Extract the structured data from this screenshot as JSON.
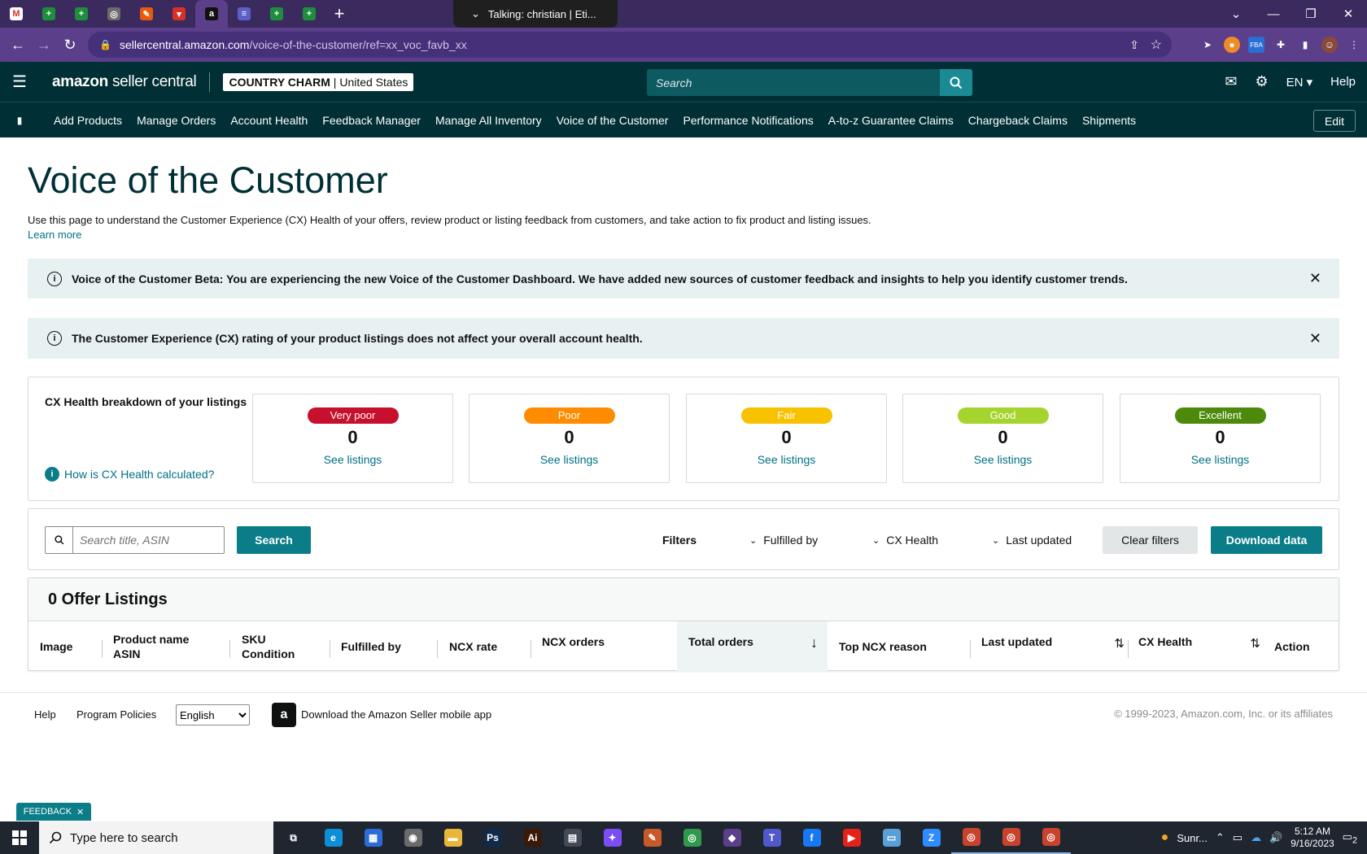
{
  "browser": {
    "tabs": [
      {
        "icon": "gmail-icon",
        "color": "#ffffff",
        "glyph": "M"
      },
      {
        "icon": "sheets-icon",
        "color": "#1e8e3e",
        "glyph": "+"
      },
      {
        "icon": "sheets-icon",
        "color": "#1e8e3e",
        "glyph": "+"
      },
      {
        "icon": "globe-icon",
        "color": "#6b6b6b",
        "glyph": "◎"
      },
      {
        "icon": "tool-icon",
        "color": "#e8590c",
        "glyph": "✎"
      },
      {
        "icon": "app-icon",
        "color": "#d93025",
        "glyph": "▾"
      },
      {
        "icon": "amazon-icon",
        "color": "#111111",
        "glyph": "a"
      },
      {
        "icon": "list-icon",
        "color": "#5b5fc7",
        "glyph": "≡"
      },
      {
        "icon": "sheets-icon",
        "color": "#1e8e3e",
        "glyph": "+"
      },
      {
        "icon": "sheets-icon",
        "color": "#1e8e3e",
        "glyph": "+"
      }
    ],
    "meeting": "Talking: christian | Eti...",
    "url_host": "sellercentral.amazon.com",
    "url_path": "/voice-of-the-customer/ref=xx_voc_favb_xx"
  },
  "header": {
    "logo_brand": "amazon",
    "logo_rest": "seller central",
    "store_name": "COUNTRY CHARM",
    "store_region": "United States",
    "search_placeholder": "Search",
    "language": "EN",
    "help": "Help"
  },
  "bookmarks": {
    "items": [
      "Add Products",
      "Manage Orders",
      "Account Health",
      "Feedback Manager",
      "Manage All Inventory",
      "Voice of the Customer",
      "Performance Notifications",
      "A-to-z Guarantee Claims",
      "Chargeback Claims",
      "Shipments"
    ],
    "edit": "Edit"
  },
  "page": {
    "title": "Voice of the Customer",
    "description": "Use this page to understand the Customer Experience (CX) Health of your offers, review product or listing feedback from customers, and take action to fix product and listing issues.",
    "learn_more": "Learn more"
  },
  "alerts": [
    "Voice of the Customer Beta: You are experiencing the new Voice of the Customer Dashboard. We have added new sources of customer feedback and insights to help you identify customer trends.",
    "The Customer Experience (CX) rating of your product listings does not affect your overall account health."
  ],
  "breakdown": {
    "title": "CX Health breakdown of your listings",
    "how_link": "How is CX Health calculated?",
    "cards": [
      {
        "label": "Very poor",
        "count": "0",
        "link": "See listings",
        "color": "#c7102e",
        "text": "#ffffff"
      },
      {
        "label": "Poor",
        "count": "0",
        "link": "See listings",
        "color": "#ff8c00",
        "text": "#ffffff"
      },
      {
        "label": "Fair",
        "count": "0",
        "link": "See listings",
        "color": "#f8c200",
        "text": "#ffffff"
      },
      {
        "label": "Good",
        "count": "0",
        "link": "See listings",
        "color": "#a6d42e",
        "text": "#ffffff"
      },
      {
        "label": "Excellent",
        "count": "0",
        "link": "See listings",
        "color": "#4d8a0c",
        "text": "#ffffff"
      }
    ]
  },
  "filters": {
    "search_placeholder": "Search title, ASIN",
    "search_button": "Search",
    "label": "Filters",
    "fulfilled_by": "Fulfilled by",
    "cx_health": "CX Health",
    "last_updated": "Last updated",
    "clear": "Clear filters",
    "download": "Download data"
  },
  "listings": {
    "title": "0 Offer Listings",
    "columns": {
      "image": "Image",
      "product_name": "Product name",
      "asin": "ASIN",
      "sku": "SKU",
      "condition": "Condition",
      "fulfilled_by": "Fulfilled by",
      "ncx_rate": "NCX rate",
      "ncx_orders": "NCX orders",
      "total_orders": "Total orders",
      "top_ncx_reason": "Top NCX reason",
      "last_updated": "Last updated",
      "cx_health": "CX Health",
      "action": "Action"
    }
  },
  "footer": {
    "help": "Help",
    "policies": "Program Policies",
    "language": "English",
    "app": "Download the Amazon Seller mobile app",
    "copyright": "© 1999-2023, Amazon.com, Inc. or its affiliates"
  },
  "feedback_tab": "FEEDBACK",
  "taskbar": {
    "search_placeholder": "Type here to search",
    "apps": [
      {
        "icon": "task-view-icon",
        "color": "#1f2630",
        "glyph": "⧉",
        "running": false
      },
      {
        "icon": "edge-icon",
        "color": "#0c8fd6",
        "glyph": "e",
        "running": false
      },
      {
        "icon": "store-icon",
        "color": "#2b6cd8",
        "glyph": "▦",
        "running": false
      },
      {
        "icon": "camera-icon",
        "color": "#6b6b6b",
        "glyph": "◉",
        "running": false
      },
      {
        "icon": "explorer-icon",
        "color": "#e8b73a",
        "glyph": "▬",
        "running": false
      },
      {
        "icon": "photoshop-icon",
        "color": "#0f2a4a",
        "glyph": "Ps",
        "running": false
      },
      {
        "icon": "illustrator-icon",
        "color": "#3a1a06",
        "glyph": "Ai",
        "running": false
      },
      {
        "icon": "calculator-icon",
        "color": "#444a55",
        "glyph": "▤",
        "running": false
      },
      {
        "icon": "messenger-icon",
        "color": "#7a4df5",
        "glyph": "✦",
        "running": false
      },
      {
        "icon": "pen-icon",
        "color": "#c85a2a",
        "glyph": "✎",
        "running": false
      },
      {
        "icon": "chrome-icon",
        "color": "#2f9a4b",
        "glyph": "◎",
        "running": false
      },
      {
        "icon": "vpn-icon",
        "color": "#5b3f8a",
        "glyph": "◆",
        "running": false
      },
      {
        "icon": "teams-icon",
        "color": "#5059c9",
        "glyph": "T",
        "running": false
      },
      {
        "icon": "facebook-icon",
        "color": "#1877f2",
        "glyph": "f",
        "running": false
      },
      {
        "icon": "youtube-icon",
        "color": "#e62117",
        "glyph": "▶",
        "running": false
      },
      {
        "icon": "notes-icon",
        "color": "#5aa0d8",
        "glyph": "▭",
        "running": false
      },
      {
        "icon": "zoom-icon",
        "color": "#2d8cff",
        "glyph": "Z",
        "running": false
      },
      {
        "icon": "chrome-icon",
        "color": "#c9432c",
        "glyph": "◎",
        "running": true
      },
      {
        "icon": "chrome-icon",
        "color": "#c9432c",
        "glyph": "◎",
        "running": true
      },
      {
        "icon": "chrome-icon",
        "color": "#c9432c",
        "glyph": "◎",
        "running": true
      }
    ],
    "weather": "Sunr...",
    "time": "5:12 AM",
    "date": "9/16/2023",
    "notifications": "2"
  }
}
